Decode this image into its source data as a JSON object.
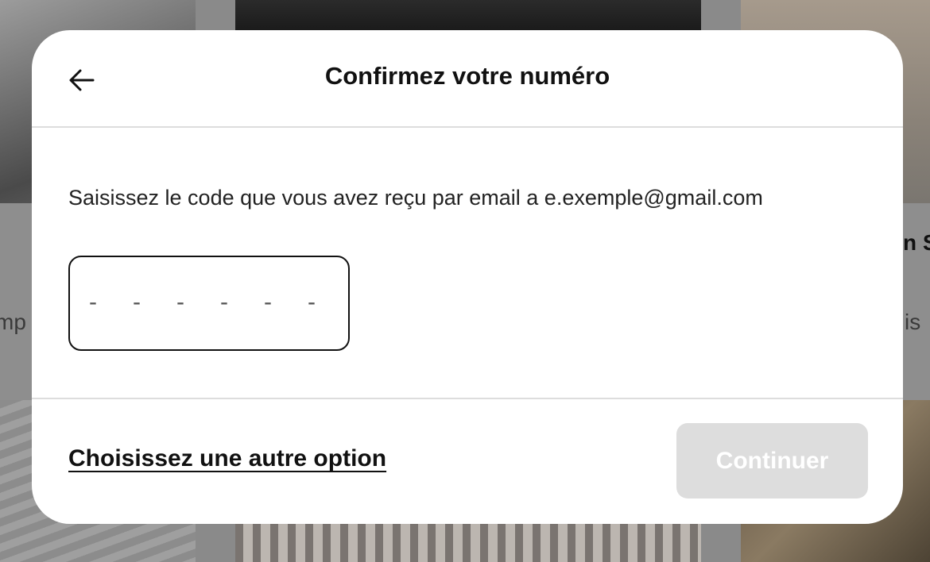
{
  "background": {
    "partial_texts": [
      "mp",
      "n S",
      "is"
    ]
  },
  "modal": {
    "back_icon": "arrow-left-icon",
    "title": "Confirmez votre numéro",
    "instruction": "Saisissez le code que vous avez reçu par email a e.exemple@gmail.com",
    "code_slots": [
      "-",
      "-",
      "-",
      "-",
      "-",
      "-"
    ],
    "other_option_label": "Choisissez une autre option",
    "continue_label": "Continuer",
    "continue_enabled": false
  },
  "colors": {
    "modal_bg": "#ffffff",
    "text_primary": "#111111",
    "divider": "#dddddd",
    "button_disabled_bg": "#dddddd",
    "button_disabled_text": "#ffffff"
  }
}
